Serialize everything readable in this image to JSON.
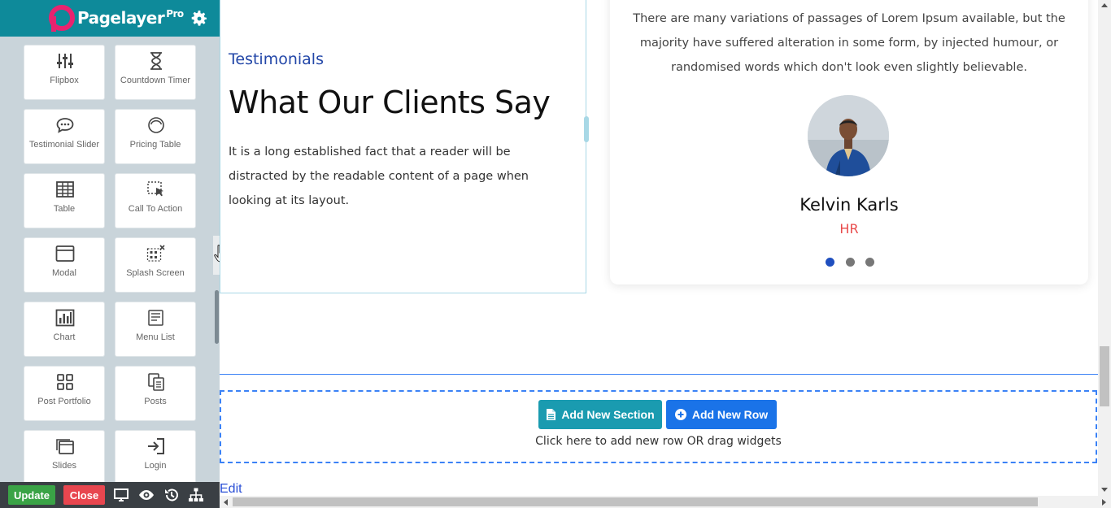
{
  "sidebar": {
    "brand": {
      "name": "Pagelayer",
      "badge": "Pro"
    },
    "widgets": [
      {
        "label": "Flipbox",
        "icon": "sliders-icon"
      },
      {
        "label": "Countdown Timer",
        "icon": "hourglass-icon"
      },
      {
        "label": "Testimonial Slider",
        "icon": "chat-bubble-icon"
      },
      {
        "label": "Pricing Table",
        "icon": "gauge-icon"
      },
      {
        "label": "Table",
        "icon": "table-icon"
      },
      {
        "label": "Call To Action",
        "icon": "pointer-icon"
      },
      {
        "label": "Modal",
        "icon": "window-icon"
      },
      {
        "label": "Splash Screen",
        "icon": "splash-icon"
      },
      {
        "label": "Chart",
        "icon": "bar-chart-icon"
      },
      {
        "label": "Menu List",
        "icon": "menu-list-icon"
      },
      {
        "label": "Post Portfolio",
        "icon": "grid-icon"
      },
      {
        "label": "Posts",
        "icon": "copy-icon"
      },
      {
        "label": "Slides",
        "icon": "slides-icon"
      },
      {
        "label": "Login",
        "icon": "sign-in-icon"
      }
    ],
    "bottom_bar": {
      "update_label": "Update",
      "close_label": "Close",
      "update_color": "#3aa346",
      "close_color": "#e8464f"
    }
  },
  "main": {
    "testimonials": {
      "tag": "Testimonials",
      "title": "What Our Clients Say",
      "description": "It is a long established fact that a reader will be distracted by the readable content of a page when looking at its layout."
    },
    "card": {
      "quote": "There are many variations of passages of Lorem Ipsum available, but the majority have suffered alteration in some form, by injected humour, or randomised words which don't look even slightly believable.",
      "name": "Kelvin Karls",
      "role": "HR",
      "slides_total": 3,
      "active_slide": 1
    },
    "add_section_label": "Add New Section",
    "add_row_label": "Add New Row",
    "add_hint": "Click here to add new row OR drag widgets",
    "edit_label": "Edit"
  },
  "colors": {
    "header_teal": "#0e8a9a",
    "accent_blue": "#1a73e8",
    "tag_blue": "#2347a8",
    "role_red": "#e84a4a"
  }
}
